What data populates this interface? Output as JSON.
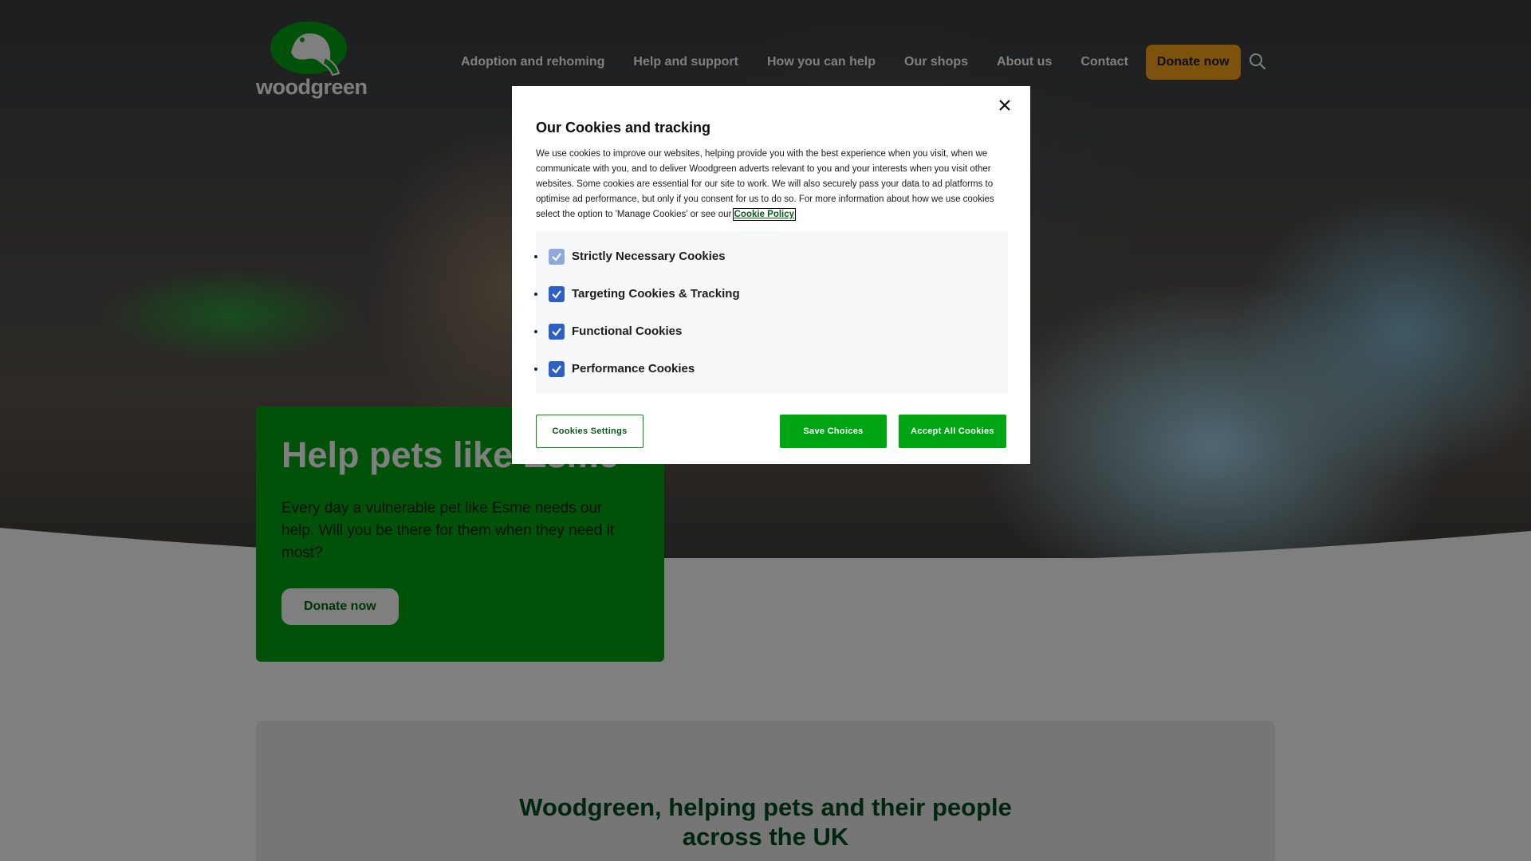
{
  "brand": {
    "name": "woodgreen",
    "logo_icon": "dog-logo-icon",
    "color": "#00a513"
  },
  "nav": {
    "items": [
      {
        "label": "Adoption and rehoming"
      },
      {
        "label": "Help and support"
      },
      {
        "label": "How you can help"
      },
      {
        "label": "Our shops"
      },
      {
        "label": "About us"
      },
      {
        "label": "Contact"
      }
    ],
    "donate_label": "Donate now",
    "search_icon": "search-icon"
  },
  "hero": {
    "title": "Help pets like Esme",
    "text": "Every day a vulnerable pet like Esme needs our help. Will you be there for them when they need it most?",
    "button_label": "Donate now"
  },
  "info": {
    "title": "Woodgreen, helping pets and their people across the UK"
  },
  "cookie_modal": {
    "title": "Our Cookies and tracking",
    "description": "We use cookies to improve our websites, helping provide you with the best experience when you visit, when we communicate with you, and to deliver Woodgreen adverts relevant to you and your interests when you visit other websites. Some cookies are essential for our site to work. We will also securely pass your data to ad platforms to optimise ad performance, but only if you consent for us to do so. For more information about how we use cookies select the option to 'Manage Cookies' or see our",
    "policy_link": "Cookie Policy",
    "preferences": [
      {
        "label": "Strictly Necessary Cookies",
        "checked": true,
        "disabled": true
      },
      {
        "label": "Targeting Cookies & Tracking",
        "checked": true,
        "disabled": false
      },
      {
        "label": "Functional Cookies",
        "checked": true,
        "disabled": false
      },
      {
        "label": "Performance Cookies",
        "checked": true,
        "disabled": false
      }
    ],
    "buttons": {
      "settings": "Cookies Settings",
      "save": "Save Choices",
      "accept": "Accept All Cookies"
    },
    "close_icon": "close-icon"
  }
}
